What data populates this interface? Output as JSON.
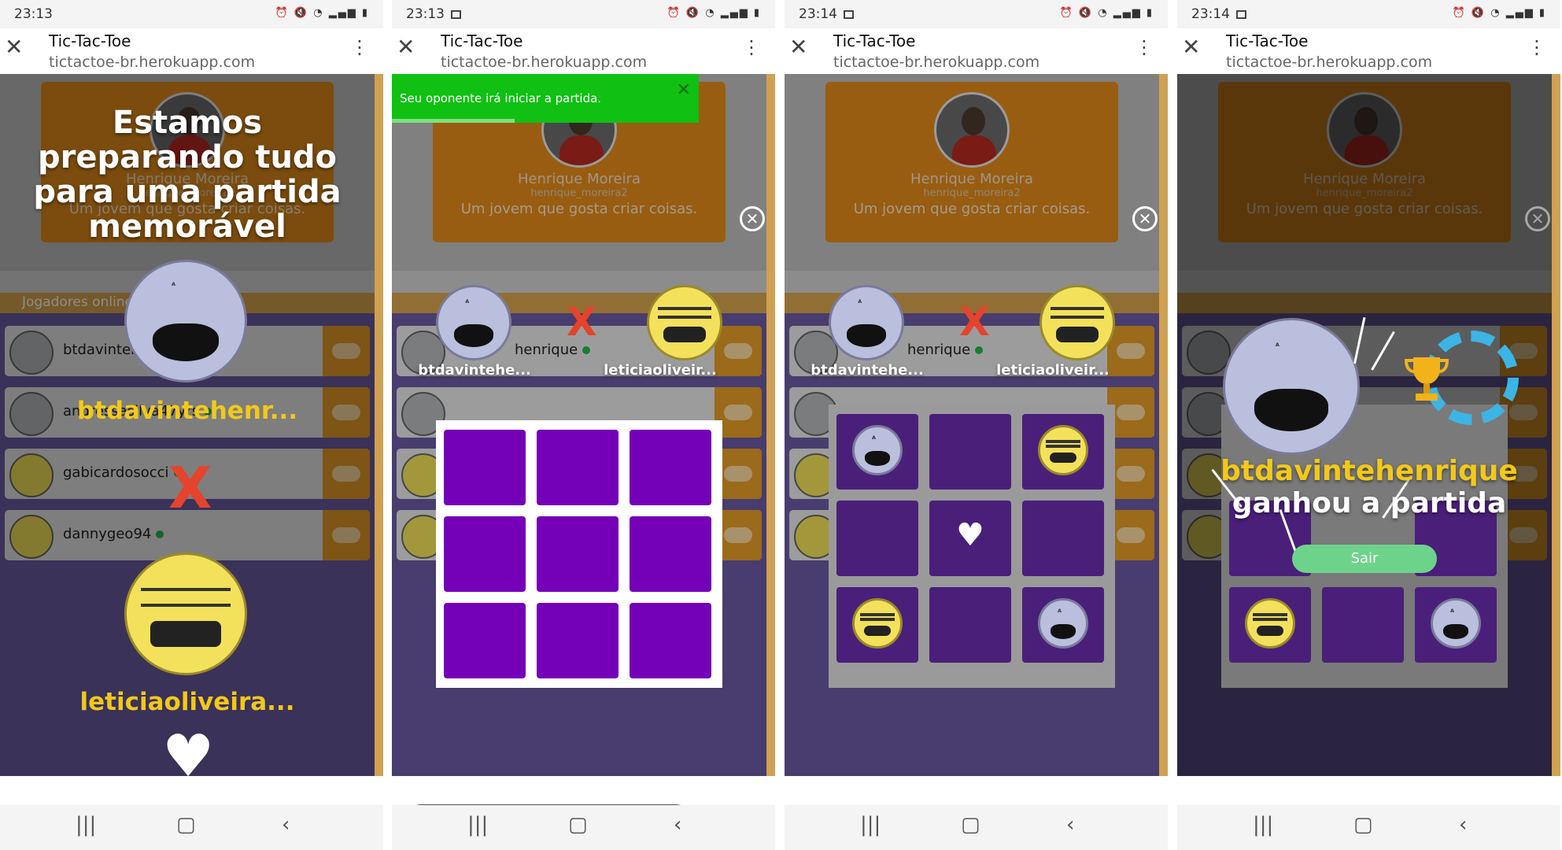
{
  "screens": [
    {
      "time": "23:13",
      "app_title": "Tic-Tac-Toe",
      "url": "tictactoe-br.herokuapp.com",
      "profile": {
        "name": "Henrique Moreira",
        "username": "henrique_moreira2",
        "bio": "Um jovem que gosta criar coisas."
      },
      "players_header": "Jogadores online",
      "players": [
        {
          "name": "btdavintehenrique",
          "online": true
        },
        {
          "name": "andressasilva47yrs",
          "online": true
        },
        {
          "name": "gabicardosocci",
          "online": true
        },
        {
          "name": "dannygeo94",
          "online": true
        }
      ],
      "overlay_title": "Estamos preparando tudo para uma partida memorável",
      "player1_name": "btdavintehenr...",
      "player2_name": "leticiaoliveira...",
      "vs": "X",
      "heart": "♥"
    },
    {
      "time": "23:13",
      "app_title": "Tic-Tac-Toe",
      "url": "tictactoe-br.herokuapp.com",
      "toast": "Seu oponente irá iniciar a partida.",
      "player1_label": "btdavintehe...",
      "player_row_text": "henrique",
      "player2_label": "leticiaoliveir...",
      "vs": "X",
      "board": [
        [
          "",
          "",
          ""
        ],
        [
          "",
          "",
          ""
        ],
        [
          "",
          "",
          ""
        ]
      ]
    },
    {
      "time": "23:14",
      "app_title": "Tic-Tac-Toe",
      "url": "tictactoe-br.herokuapp.com",
      "player1_label": "btdavintehe...",
      "player_row_text": "henrique",
      "player2_label": "leticiaoliveir...",
      "vs": "X",
      "board": [
        [
          "ghost",
          "",
          "meme"
        ],
        [
          "",
          "heart",
          ""
        ],
        [
          "meme",
          "",
          "ghost"
        ]
      ]
    },
    {
      "time": "23:14",
      "app_title": "Tic-Tac-Toe",
      "url": "tictactoe-br.herokuapp.com",
      "winner": "btdavintehenrique",
      "win_suffix": "ganhou a partida",
      "exit_button": "Sair"
    }
  ],
  "colors": {
    "accent_orange": "#e08a1a",
    "board_purple": "#7400b8",
    "toast_green": "#10c012",
    "winner_yellow": "#f2c81a"
  },
  "icons": [
    "close-icon",
    "menu-dots-icon",
    "gamepad-icon",
    "heart-icon",
    "close-circle-icon",
    "trophy-icon",
    "share-icon",
    "crop-icon",
    "scroll-capture-icon"
  ]
}
